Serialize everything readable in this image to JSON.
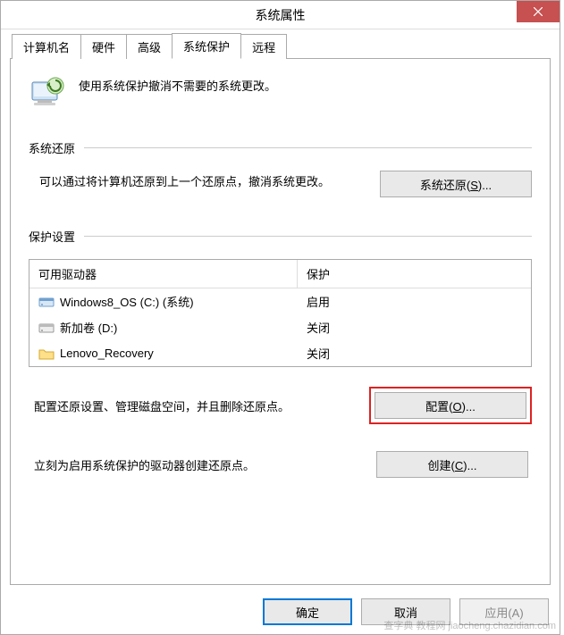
{
  "window": {
    "title": "系统属性"
  },
  "tabs": [
    {
      "label": "计算机名"
    },
    {
      "label": "硬件"
    },
    {
      "label": "高级"
    },
    {
      "label": "系统保护"
    },
    {
      "label": "远程"
    }
  ],
  "intro": {
    "text": "使用系统保护撤消不需要的系统更改。"
  },
  "restore": {
    "group_title": "系统还原",
    "text": "可以通过将计算机还原到上一个还原点，撤消系统更改。",
    "button_label": "系统还原(S)...",
    "button_access": "S"
  },
  "protection": {
    "group_title": "保护设置",
    "col_drive": "可用驱动器",
    "col_protection": "保护",
    "drives": [
      {
        "icon": "drive-system",
        "name": "Windows8_OS (C:) (系统)",
        "status": "启用"
      },
      {
        "icon": "drive",
        "name": "新加卷 (D:)",
        "status": "关闭"
      },
      {
        "icon": "folder",
        "name": "Lenovo_Recovery",
        "status": "关闭"
      }
    ],
    "config_text": "配置还原设置、管理磁盘空间，并且删除还原点。",
    "config_button": "配置(O)...",
    "config_access": "O",
    "create_text": "立刻为启用系统保护的驱动器创建还原点。",
    "create_button": "创建(C)...",
    "create_access": "C"
  },
  "footer": {
    "ok": "确定",
    "cancel": "取消",
    "apply": "应用(A)"
  },
  "watermark": "查字典 教程网 jiaocheng.chazidian.com"
}
